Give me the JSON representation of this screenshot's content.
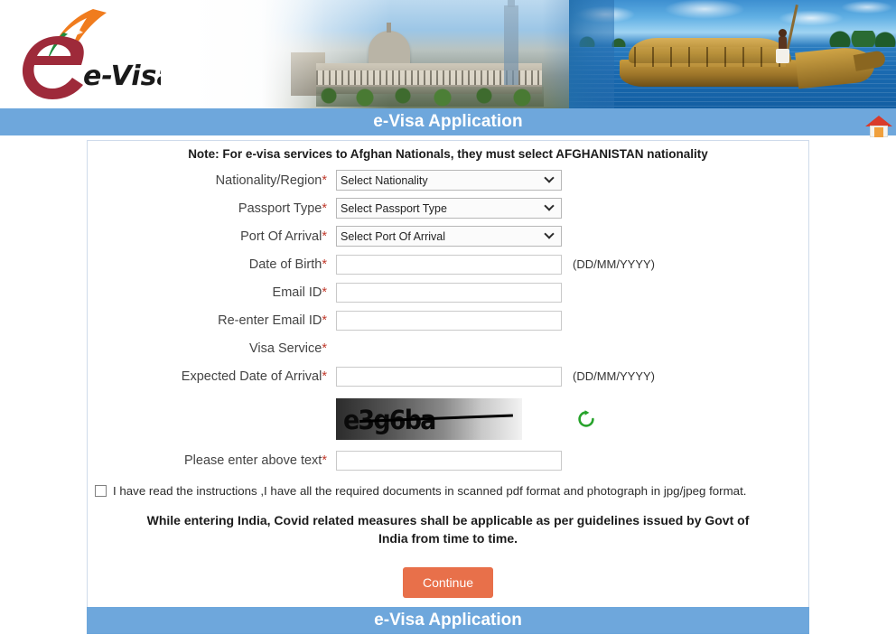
{
  "header": {
    "logo_text": "e-Visa",
    "logo_alt": "e-Visa logo with Indian tricolour swoosh",
    "banner_alt": "Rashtrapati Bhavan and Kerala houseboat banner",
    "title": "e-Visa Application",
    "home_icon_name": "home-icon"
  },
  "form": {
    "note": "Note: For e-visa services to Afghan Nationals, they must select AFGHANISTAN nationality",
    "fields": [
      {
        "label": "Nationality/Region",
        "required": "*",
        "type": "select",
        "value": "Select Nationality",
        "hint": ""
      },
      {
        "label": "Passport Type",
        "required": "*",
        "type": "select",
        "value": "Select Passport Type",
        "hint": ""
      },
      {
        "label": "Port Of Arrival",
        "required": "*",
        "type": "select",
        "value": "Select Port Of Arrival",
        "hint": ""
      },
      {
        "label": "Date of Birth",
        "required": "*",
        "type": "text",
        "value": "",
        "hint": "(DD/MM/YYYY)"
      },
      {
        "label": "Email ID",
        "required": "*",
        "type": "text",
        "value": "",
        "hint": ""
      },
      {
        "label": "Re-enter Email ID",
        "required": "*",
        "type": "text",
        "value": "",
        "hint": ""
      },
      {
        "label": "Visa Service",
        "required": "*",
        "type": "none",
        "value": "",
        "hint": ""
      },
      {
        "label": "Expected Date of Arrival",
        "required": "*",
        "type": "text",
        "value": "",
        "hint": "(DD/MM/YYYY)"
      }
    ],
    "captcha": {
      "text": "e3g6ba",
      "refresh_icon_name": "refresh-icon",
      "answer_label": "Please enter above text",
      "answer_required": "*",
      "answer_value": ""
    },
    "consent": {
      "checked": false,
      "text": "I have read the instructions ,I have all the required documents in scanned pdf format and photograph in jpg/jpeg format."
    },
    "covid_notice": "While entering India, Covid related measures shall be applicable as per guidelines issued by Govt of India from time to time.",
    "submit_label": "Continue"
  },
  "footer": {
    "title": "e-Visa Application"
  },
  "colors": {
    "bar_blue": "#6ea7dc",
    "button_orange": "#e8704a",
    "required_red": "#c0392b",
    "refresh_green": "#27a32b",
    "logo_maroon": "#9e2a3a"
  }
}
